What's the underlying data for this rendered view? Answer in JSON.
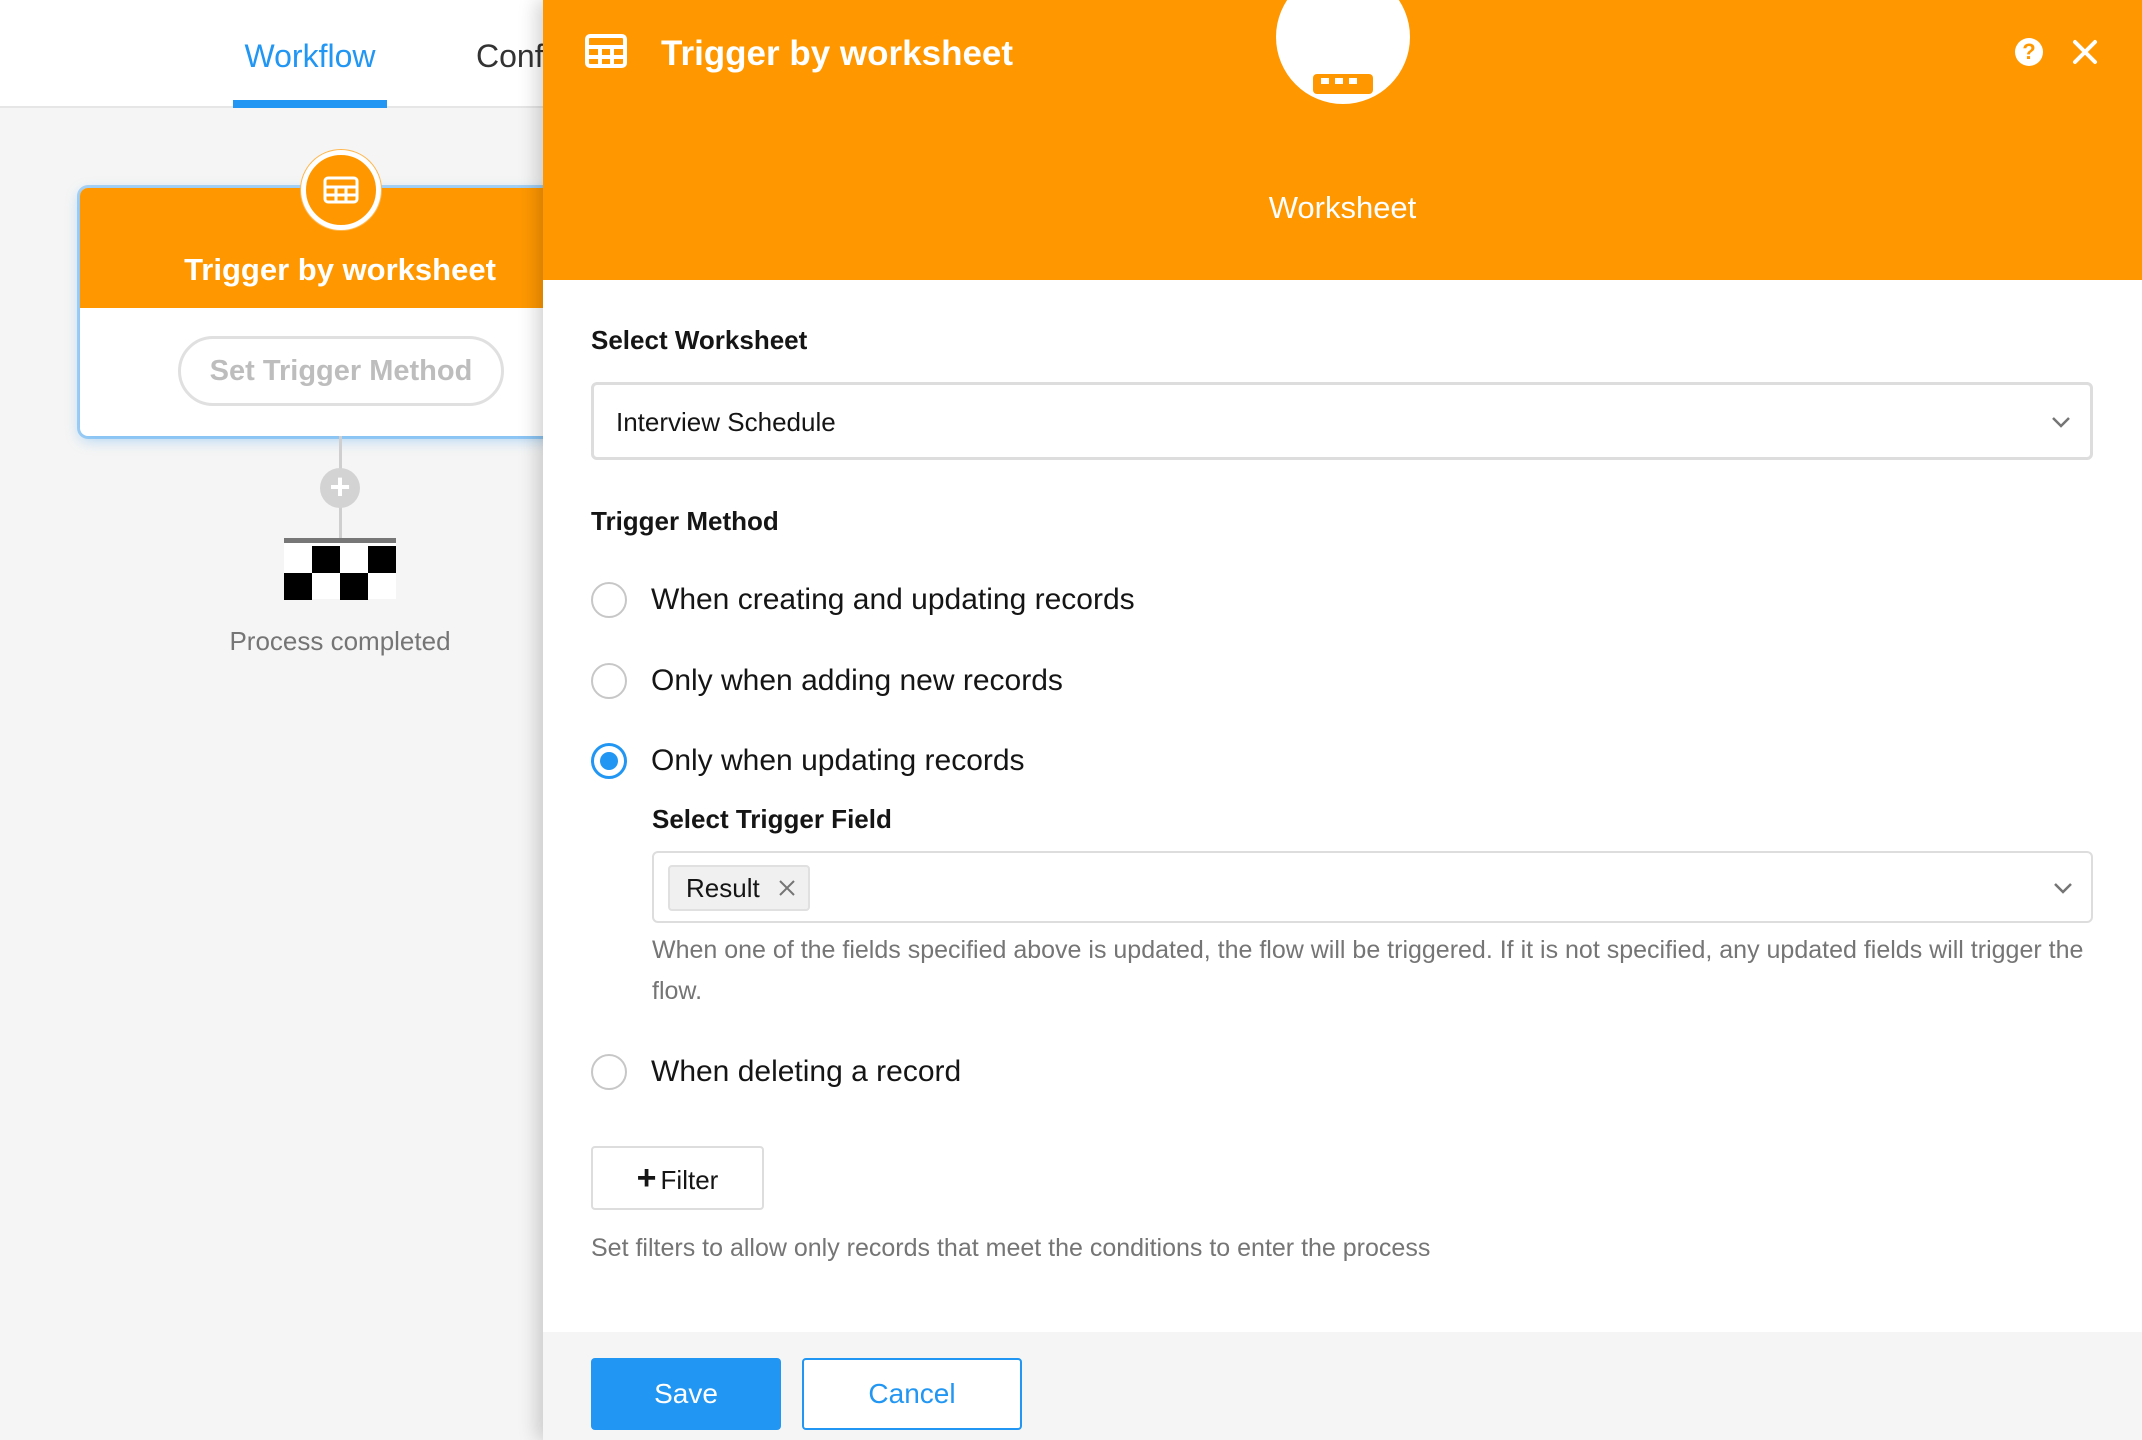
{
  "tabs": {
    "workflow": "Workflow",
    "config": "Conf"
  },
  "node": {
    "title": "Trigger by worksheet",
    "method_button": "Set Trigger Method",
    "icon": "table-icon"
  },
  "flow": {
    "end_label": "Process completed",
    "add_icon": "plus-icon",
    "end_icon": "checkered-flag-icon"
  },
  "drawer": {
    "title": "Trigger by worksheet",
    "header_icon": "table-icon",
    "help_icon": "question-icon",
    "close_icon": "close-icon",
    "hero_label": "Worksheet",
    "select_worksheet_label": "Select Worksheet",
    "worksheet_value": "Interview Schedule",
    "trigger_method_label": "Trigger Method",
    "trigger_options": [
      {
        "label": "When creating and updating records",
        "checked": false
      },
      {
        "label": "Only when adding new records",
        "checked": false
      },
      {
        "label": "Only when updating records",
        "checked": true
      },
      {
        "label": "When deleting a record",
        "checked": false
      }
    ],
    "trigger_field_label": "Select Trigger Field",
    "trigger_field_tags": [
      "Result"
    ],
    "trigger_field_hint": "When one of the fields specified above is updated, the flow will be triggered. If it is not specified, any updated fields will trigger the flow.",
    "filter_button": "Filter",
    "filter_hint": "Set filters to allow only records that meet the conditions to enter the process",
    "save_button": "Save",
    "cancel_button": "Cancel"
  },
  "colors": {
    "accent_orange": "#ff9800",
    "primary_blue": "#2196f3",
    "muted_text": "#757575"
  }
}
